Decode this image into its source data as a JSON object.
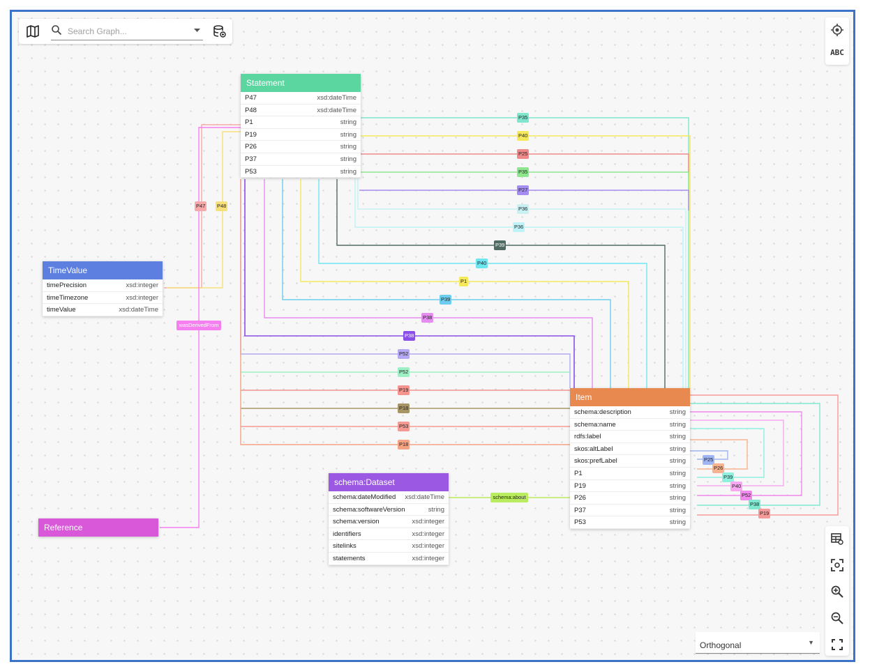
{
  "toolbar": {
    "search_placeholder": "Search Graph...",
    "icons": [
      "map-icon",
      "search-icon",
      "chevron-down-icon",
      "database-icon"
    ]
  },
  "view_controls": {
    "text_toggle": "ABC",
    "icons": [
      "locate-icon",
      "table-icon",
      "focus-icon",
      "zoom-in-icon",
      "zoom-out-icon",
      "fullscreen-icon"
    ]
  },
  "layout_select": {
    "value": "Orthogonal"
  },
  "colors": {
    "frame": "#3b73c9",
    "statement": "#5bd6a0",
    "timevalue": "#5d7fe0",
    "item": "#e8894f",
    "dataset": "#9a58e3",
    "reference": "#d957d9"
  },
  "nodes": {
    "statement": {
      "title": "Statement",
      "props": [
        {
          "name": "P47",
          "type": "xsd:dateTime"
        },
        {
          "name": "P48",
          "type": "xsd:dateTime"
        },
        {
          "name": "P1",
          "type": "string"
        },
        {
          "name": "P19",
          "type": "string"
        },
        {
          "name": "P26",
          "type": "string"
        },
        {
          "name": "P37",
          "type": "string"
        },
        {
          "name": "P53",
          "type": "string"
        }
      ]
    },
    "timevalue": {
      "title": "TimeValue",
      "props": [
        {
          "name": "timePrecision",
          "type": "xsd:integer"
        },
        {
          "name": "timeTimezone",
          "type": "xsd:integer"
        },
        {
          "name": "timeValue",
          "type": "xsd:dateTime"
        }
      ]
    },
    "item": {
      "title": "Item",
      "props": [
        {
          "name": "schema:description",
          "type": "string"
        },
        {
          "name": "schema:name",
          "type": "string"
        },
        {
          "name": "rdfs:label",
          "type": "string"
        },
        {
          "name": "skos:altLabel",
          "type": "string"
        },
        {
          "name": "skos:prefLabel",
          "type": "string"
        },
        {
          "name": "P1",
          "type": "string"
        },
        {
          "name": "P19",
          "type": "string"
        },
        {
          "name": "P26",
          "type": "string"
        },
        {
          "name": "P37",
          "type": "string"
        },
        {
          "name": "P53",
          "type": "string"
        }
      ]
    },
    "dataset": {
      "title": "schema:Dataset",
      "props": [
        {
          "name": "schema:dateModified",
          "type": "xsd:dateTime"
        },
        {
          "name": "schema:softwareVersion",
          "type": "string"
        },
        {
          "name": "schema:version",
          "type": "xsd:integer"
        },
        {
          "name": "identifiers",
          "type": "xsd:integer"
        },
        {
          "name": "sitelinks",
          "type": "xsd:integer"
        },
        {
          "name": "statements",
          "type": "xsd:integer"
        }
      ]
    },
    "reference": {
      "title": "Reference"
    }
  },
  "edges": {
    "top": [
      {
        "label": "P35",
        "color": "#7fe5cc"
      },
      {
        "label": "P40",
        "color": "#f5e85a"
      },
      {
        "label": "P25",
        "color": "#f08a8a"
      },
      {
        "label": "P35",
        "color": "#8fe68f"
      },
      {
        "label": "P27",
        "color": "#a58cf0"
      },
      {
        "label": "P36",
        "color": "#c7f1f4"
      },
      {
        "label": "P36",
        "color": "#bdf3f6"
      }
    ],
    "down": [
      {
        "label": "P39",
        "color": "#4f6b62"
      },
      {
        "label": "P40",
        "color": "#6ee6f2"
      },
      {
        "label": "P1",
        "color": "#f5e85a"
      },
      {
        "label": "P39",
        "color": "#6ccdf0"
      },
      {
        "label": "P38",
        "color": "#e58ef0"
      },
      {
        "label": "P38",
        "color": "#8a4fe8"
      }
    ],
    "left": [
      {
        "label": "P52",
        "color": "#b4a8f2"
      },
      {
        "label": "P52",
        "color": "#9ef0c4"
      },
      {
        "label": "P19",
        "color": "#f5938e"
      },
      {
        "label": "P18",
        "color": "#a89565"
      },
      {
        "label": "P53",
        "color": "#f59a92"
      },
      {
        "label": "P18",
        "color": "#f5a283"
      }
    ],
    "vertical": [
      {
        "label": "P47",
        "color": "#f7a8a8"
      },
      {
        "label": "P48",
        "color": "#f7e07a"
      }
    ],
    "derived": {
      "label": "wasDerivedFrom",
      "color": "#f57ff0"
    },
    "about": {
      "label": "schema:about",
      "color": "#b9ec5e"
    },
    "self": [
      {
        "label": "P25",
        "color": "#9fb4f2"
      },
      {
        "label": "P26",
        "color": "#f7b38f"
      },
      {
        "label": "P39",
        "color": "#8ff0e0"
      },
      {
        "label": "P40",
        "color": "#f7a8f0"
      },
      {
        "label": "P52",
        "color": "#f08aec"
      },
      {
        "label": "P38",
        "color": "#7fe8d0"
      },
      {
        "label": "P19",
        "color": "#f59a9a"
      }
    ]
  }
}
